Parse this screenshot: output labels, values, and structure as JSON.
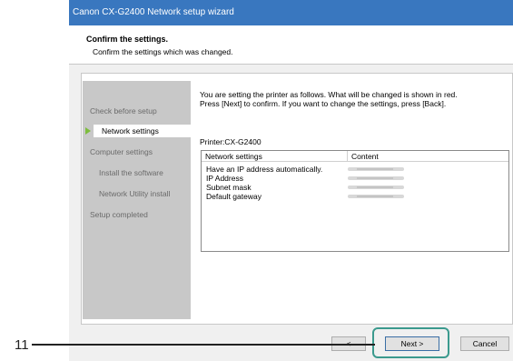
{
  "window": {
    "title": "Canon CX-G2400 Network setup wizard"
  },
  "header": {
    "title": "Confirm the settings.",
    "subtitle": "Confirm the settings which was changed."
  },
  "sidebar": {
    "items": [
      {
        "label": "Check before setup"
      },
      {
        "label": "Network settings"
      },
      {
        "label": "Computer settings"
      },
      {
        "label": "Install the software"
      },
      {
        "label": "Network Utility install"
      },
      {
        "label": "Setup completed"
      }
    ]
  },
  "main": {
    "info_line1": "You are setting the printer as follows. What will be changed is shown in red.",
    "info_line2": "Press [Next] to confirm. If you want to change the settings, press [Back].",
    "printer_label": "Printer:CX-G2400",
    "table": {
      "headers": [
        "Network settings",
        "Content"
      ],
      "rows": [
        {
          "setting": "Have an IP address automatically."
        },
        {
          "setting": "IP Address"
        },
        {
          "setting": "Subnet mask"
        },
        {
          "setting": "Default gateway"
        }
      ]
    }
  },
  "buttons": {
    "back_label": "<",
    "next_label": "Next >",
    "cancel_label": "Cancel"
  },
  "callout": {
    "number": "11"
  },
  "colors": {
    "titlebar": "#3977bf",
    "callout_highlight": "#3b9a8e",
    "active_arrow": "#7dbd3d"
  }
}
